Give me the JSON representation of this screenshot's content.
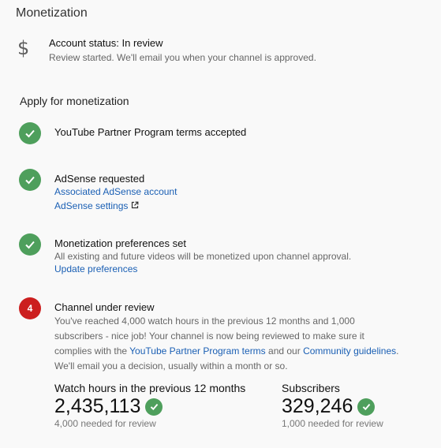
{
  "page": {
    "title": "Monetization"
  },
  "account_status": {
    "icon": "dollar-icon",
    "title": "Account status: In review",
    "subtitle": "Review started. We'll email you when your channel is approved."
  },
  "apply": {
    "heading": "Apply for monetization",
    "steps": [
      {
        "status": "done",
        "icon": "check-icon",
        "title": "YouTube Partner Program terms accepted"
      },
      {
        "status": "done",
        "icon": "check-icon",
        "title": "AdSense requested",
        "links": [
          "Associated AdSense account",
          "AdSense settings"
        ],
        "external_icon": "external-link-icon"
      },
      {
        "status": "done",
        "icon": "check-icon",
        "title": "Monetization preferences set",
        "text": "All existing and future videos will be monetized upon channel approval.",
        "link": "Update preferences"
      },
      {
        "status": "current",
        "number": "4",
        "title": "Channel under review",
        "text_1": "You've reached 4,000 watch hours in the previous 12 months and 1,000 subscribers - nice job! Your channel is now being reviewed to make sure it complies with the ",
        "link_1": "YouTube Partner Program terms",
        "text_2": " and our ",
        "link_2": "Community guidelines",
        "text_3": ". We'll email you a decision, usually within a month or so."
      }
    ]
  },
  "metrics": {
    "watch_hours": {
      "label": "Watch hours in the previous 12 months",
      "value": "2,435,113",
      "note": "4,000 needed for review"
    },
    "subscribers": {
      "label": "Subscribers",
      "value": "329,246",
      "note": "1,000 needed for review"
    }
  },
  "colors": {
    "success": "#4e9f5c",
    "alert": "#cc1f1f",
    "link": "#1a5fb4"
  }
}
